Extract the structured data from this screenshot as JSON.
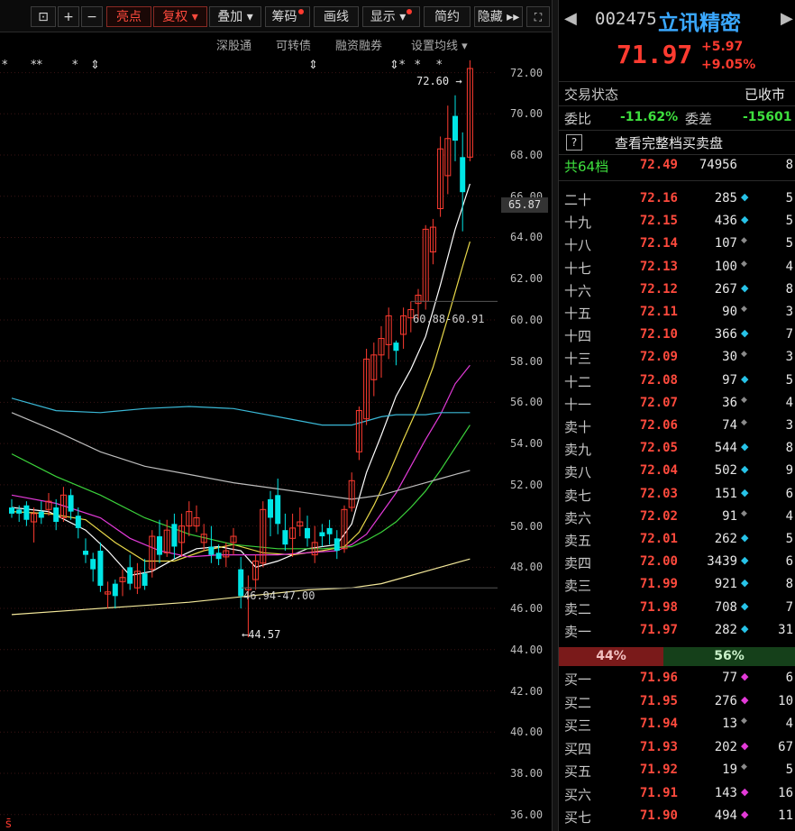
{
  "toolbar": {
    "buttons": [
      "亮点",
      "复权",
      "叠加",
      "筹码",
      "画线",
      "显示",
      "简约",
      "隐藏"
    ],
    "sub": [
      "深股通",
      "可转债",
      "融资融券",
      "设置均线"
    ]
  },
  "chart_data": {
    "type": "candlestick",
    "ylim": [
      35.2,
      72.9
    ],
    "yticks": [
      "72.00",
      "70.00",
      "68.00",
      "66.00",
      "64.00",
      "62.00",
      "60.00",
      "58.00",
      "56.00",
      "54.00",
      "52.00",
      "50.00",
      "48.00",
      "46.00",
      "44.00",
      "42.00",
      "40.00",
      "38.00",
      "36.00"
    ],
    "current_price_label": "65.87",
    "annotations": {
      "high": "72.60",
      "low": "44.57",
      "range_low": "46.94-47.00",
      "range_mid": "60.88-60.91"
    },
    "candles": [
      [
        50.9,
        51.3,
        50.4,
        50.6,
        "d"
      ],
      [
        50.6,
        51.0,
        50.2,
        50.8,
        "d"
      ],
      [
        51.0,
        51.2,
        50.0,
        50.3,
        "d"
      ],
      [
        50.2,
        50.9,
        49.2,
        50.6,
        "u"
      ],
      [
        50.7,
        51.2,
        50.1,
        50.4,
        "d"
      ],
      [
        50.8,
        51.6,
        50.5,
        51.2,
        "u"
      ],
      [
        50.9,
        51.3,
        49.8,
        50.2,
        "d"
      ],
      [
        50.4,
        51.9,
        50.2,
        51.5,
        "u"
      ],
      [
        51.5,
        51.8,
        50.3,
        50.7,
        "d"
      ],
      [
        50.5,
        50.9,
        49.4,
        49.9,
        "d"
      ],
      [
        48.8,
        49.4,
        48.2,
        48.6,
        "d"
      ],
      [
        48.4,
        48.7,
        47.3,
        47.9,
        "d"
      ],
      [
        48.8,
        49.2,
        46.8,
        47.1,
        "d"
      ],
      [
        46.8,
        47.3,
        46.0,
        46.7,
        "u"
      ],
      [
        46.6,
        47.4,
        46.0,
        47.2,
        "d"
      ],
      [
        47.3,
        47.9,
        46.6,
        47.5,
        "u"
      ],
      [
        48.0,
        48.6,
        46.9,
        47.2,
        "d"
      ],
      [
        47.0,
        48.2,
        46.7,
        47.8,
        "u"
      ],
      [
        47.7,
        48.4,
        46.9,
        47.1,
        "d"
      ],
      [
        47.9,
        49.8,
        47.5,
        49.5,
        "u"
      ],
      [
        49.5,
        50.3,
        48.2,
        48.6,
        "d"
      ],
      [
        48.7,
        50.3,
        48.5,
        49.8,
        "u"
      ],
      [
        50.1,
        50.6,
        48.4,
        49.0,
        "d"
      ],
      [
        49.2,
        50.6,
        48.5,
        50.0,
        "u"
      ],
      [
        50.0,
        51.2,
        49.5,
        50.7,
        "u"
      ],
      [
        50.0,
        51.0,
        49.7,
        50.4,
        "u"
      ],
      [
        49.2,
        50.1,
        48.8,
        49.6,
        "u"
      ],
      [
        49.0,
        50.0,
        48.2,
        48.6,
        "d"
      ],
      [
        48.7,
        49.1,
        48.1,
        48.4,
        "d"
      ],
      [
        48.8,
        49.2,
        48.0,
        48.5,
        "u"
      ],
      [
        49.2,
        49.9,
        48.6,
        49.5,
        "u"
      ],
      [
        47.9,
        48.5,
        46.0,
        46.6,
        "d"
      ],
      [
        46.9,
        47.6,
        44.6,
        47.0,
        "u"
      ],
      [
        47.4,
        48.6,
        46.9,
        48.3,
        "u"
      ],
      [
        48.2,
        51.2,
        48.0,
        50.8,
        "u"
      ],
      [
        51.3,
        51.7,
        49.5,
        50.4,
        "d"
      ],
      [
        51.5,
        52.3,
        49.6,
        50.1,
        "d"
      ],
      [
        49.8,
        50.6,
        48.8,
        49.1,
        "d"
      ],
      [
        49.4,
        50.6,
        48.5,
        49.9,
        "u"
      ],
      [
        50.0,
        50.9,
        49.5,
        50.2,
        "u"
      ],
      [
        49.9,
        50.5,
        49.0,
        49.4,
        "d"
      ],
      [
        48.6,
        50.0,
        48.2,
        49.2,
        "u"
      ],
      [
        49.5,
        50.1,
        49.0,
        49.7,
        "d"
      ],
      [
        49.6,
        50.3,
        49.1,
        49.9,
        "d"
      ],
      [
        49.4,
        49.8,
        48.4,
        48.8,
        "d"
      ],
      [
        48.9,
        51.0,
        48.7,
        50.8,
        "u"
      ],
      [
        50.9,
        52.6,
        50.7,
        52.2,
        "u"
      ],
      [
        53.6,
        55.8,
        53.2,
        55.6,
        "u"
      ],
      [
        55.2,
        58.6,
        54.9,
        58.1,
        "u"
      ],
      [
        57.1,
        58.9,
        56.3,
        58.3,
        "u"
      ],
      [
        58.3,
        59.7,
        57.2,
        59.1,
        "u"
      ],
      [
        58.8,
        60.6,
        58.1,
        60.2,
        "u"
      ],
      [
        58.5,
        59.0,
        57.8,
        58.9,
        "d"
      ],
      [
        59.3,
        60.6,
        58.6,
        60.2,
        "u"
      ],
      [
        60.1,
        60.9,
        59.4,
        60.5,
        "u"
      ],
      [
        60.8,
        61.5,
        60.0,
        61.2,
        "u"
      ],
      [
        60.9,
        64.6,
        60.5,
        64.4,
        "u"
      ],
      [
        63.3,
        64.9,
        62.7,
        64.5,
        "u"
      ],
      [
        65.4,
        68.9,
        65.0,
        68.3,
        "u"
      ],
      [
        67.0,
        70.4,
        66.1,
        68.8,
        "u"
      ],
      [
        69.9,
        70.9,
        67.7,
        68.7,
        "d"
      ],
      [
        67.9,
        69.1,
        64.3,
        66.2,
        "d"
      ],
      [
        67.9,
        72.6,
        67.7,
        72.2,
        "u"
      ]
    ],
    "ma_lines": [
      {
        "color": "#ffffff",
        "points": [
          [
            0,
            50.9
          ],
          [
            5,
            50.7
          ],
          [
            10,
            49.8
          ],
          [
            13,
            48.8
          ],
          [
            16,
            47.6
          ],
          [
            19,
            47.8
          ],
          [
            22,
            48.4
          ],
          [
            25,
            48.9
          ],
          [
            28,
            49.0
          ],
          [
            31,
            48.8
          ],
          [
            33,
            48.0
          ],
          [
            36,
            48.3
          ],
          [
            40,
            48.9
          ],
          [
            44,
            49.1
          ],
          [
            46,
            50.1
          ],
          [
            48,
            52.6
          ],
          [
            50,
            54.4
          ],
          [
            52,
            56.3
          ],
          [
            54,
            57.6
          ],
          [
            56,
            59.2
          ],
          [
            58,
            61.7
          ],
          [
            60,
            64.4
          ],
          [
            62,
            66.6
          ]
        ]
      },
      {
        "color": "#e8d84a",
        "points": [
          [
            0,
            50.7
          ],
          [
            5,
            50.6
          ],
          [
            10,
            50.3
          ],
          [
            14,
            49.2
          ],
          [
            18,
            48.3
          ],
          [
            22,
            48.3
          ],
          [
            26,
            48.8
          ],
          [
            30,
            49.1
          ],
          [
            34,
            48.7
          ],
          [
            38,
            48.6
          ],
          [
            42,
            48.8
          ],
          [
            45,
            49.0
          ],
          [
            47,
            49.7
          ],
          [
            49,
            51.0
          ],
          [
            51,
            52.5
          ],
          [
            53,
            54.2
          ],
          [
            55,
            55.8
          ],
          [
            57,
            57.7
          ],
          [
            59,
            60.1
          ],
          [
            61,
            62.6
          ],
          [
            62,
            63.8
          ]
        ]
      },
      {
        "color": "#e23ad8",
        "points": [
          [
            0,
            51.5
          ],
          [
            6,
            51.1
          ],
          [
            12,
            50.4
          ],
          [
            16,
            49.4
          ],
          [
            20,
            48.8
          ],
          [
            24,
            48.5
          ],
          [
            28,
            48.6
          ],
          [
            32,
            48.6
          ],
          [
            36,
            48.6
          ],
          [
            40,
            48.7
          ],
          [
            44,
            48.8
          ],
          [
            46,
            49.1
          ],
          [
            48,
            49.6
          ],
          [
            50,
            50.6
          ],
          [
            52,
            51.6
          ],
          [
            54,
            52.9
          ],
          [
            56,
            54.2
          ],
          [
            58,
            55.4
          ],
          [
            60,
            56.9
          ],
          [
            62,
            57.8
          ]
        ]
      },
      {
        "color": "#3bd23b",
        "points": [
          [
            0,
            53.5
          ],
          [
            6,
            52.4
          ],
          [
            12,
            51.5
          ],
          [
            18,
            50.4
          ],
          [
            24,
            49.6
          ],
          [
            30,
            49.1
          ],
          [
            36,
            48.9
          ],
          [
            42,
            48.9
          ],
          [
            46,
            49.0
          ],
          [
            48,
            49.3
          ],
          [
            50,
            49.7
          ],
          [
            52,
            50.2
          ],
          [
            54,
            50.9
          ],
          [
            56,
            51.7
          ],
          [
            58,
            52.7
          ],
          [
            60,
            53.8
          ],
          [
            62,
            54.9
          ]
        ]
      },
      {
        "color": "#bdbdbd",
        "points": [
          [
            0,
            55.5
          ],
          [
            6,
            54.6
          ],
          [
            12,
            53.6
          ],
          [
            18,
            52.9
          ],
          [
            24,
            52.5
          ],
          [
            30,
            52.1
          ],
          [
            36,
            51.8
          ],
          [
            42,
            51.5
          ],
          [
            46,
            51.3
          ],
          [
            48,
            51.4
          ],
          [
            50,
            51.5
          ],
          [
            52,
            51.7
          ],
          [
            54,
            51.9
          ],
          [
            56,
            52.1
          ],
          [
            58,
            52.3
          ],
          [
            60,
            52.5
          ],
          [
            62,
            52.7
          ]
        ]
      },
      {
        "color": "#3ab8d6",
        "points": [
          [
            0,
            56.2
          ],
          [
            6,
            55.6
          ],
          [
            12,
            55.5
          ],
          [
            18,
            55.7
          ],
          [
            24,
            55.8
          ],
          [
            30,
            55.7
          ],
          [
            36,
            55.3
          ],
          [
            42,
            54.9
          ],
          [
            46,
            54.9
          ],
          [
            48,
            55.1
          ],
          [
            50,
            55.3
          ],
          [
            52,
            55.4
          ],
          [
            54,
            55.4
          ],
          [
            56,
            55.4
          ],
          [
            58,
            55.5
          ],
          [
            60,
            55.5
          ],
          [
            62,
            55.5
          ]
        ]
      },
      {
        "color": "#f3e89a",
        "points": [
          [
            0,
            45.7
          ],
          [
            8,
            45.9
          ],
          [
            16,
            46.1
          ],
          [
            24,
            46.3
          ],
          [
            32,
            46.6
          ],
          [
            40,
            46.9
          ],
          [
            46,
            47.0
          ],
          [
            50,
            47.2
          ],
          [
            54,
            47.6
          ],
          [
            58,
            48.0
          ],
          [
            62,
            48.4
          ]
        ]
      }
    ]
  },
  "quote": {
    "code": "002475",
    "name": "立讯精密",
    "price": "71.97",
    "change": "+5.97",
    "pct": "+9.05%",
    "status_label": "交易状态",
    "status_value": "已收市",
    "weibi_label": "委比",
    "weibi_value": "-11.62%",
    "weicha_label": "委差",
    "weicha_value": "-15601",
    "help_icon": "?",
    "full_book_label": "查看完整档买卖盘",
    "total_label": "共64档",
    "total_price": "72.49",
    "total_vol": "74956",
    "total_cnt": "8",
    "ratio_buy": "44%",
    "ratio_sell": "56%"
  },
  "asks": [
    {
      "lvl": "二十",
      "px": "72.16",
      "vol": "285",
      "mark": "blue",
      "cnt": "5"
    },
    {
      "lvl": "十九",
      "px": "72.15",
      "vol": "436",
      "mark": "blue",
      "cnt": "5"
    },
    {
      "lvl": "十八",
      "px": "72.14",
      "vol": "107",
      "mark": "gray",
      "cnt": "5"
    },
    {
      "lvl": "十七",
      "px": "72.13",
      "vol": "100",
      "mark": "gray",
      "cnt": "4"
    },
    {
      "lvl": "十六",
      "px": "72.12",
      "vol": "267",
      "mark": "blue",
      "cnt": "8"
    },
    {
      "lvl": "十五",
      "px": "72.11",
      "vol": "90",
      "mark": "gray",
      "cnt": "3"
    },
    {
      "lvl": "十四",
      "px": "72.10",
      "vol": "366",
      "mark": "blue",
      "cnt": "7"
    },
    {
      "lvl": "十三",
      "px": "72.09",
      "vol": "30",
      "mark": "gray",
      "cnt": "3"
    },
    {
      "lvl": "十二",
      "px": "72.08",
      "vol": "97",
      "mark": "blue",
      "cnt": "5"
    },
    {
      "lvl": "十一",
      "px": "72.07",
      "vol": "36",
      "mark": "gray",
      "cnt": "4"
    },
    {
      "lvl": "卖十",
      "px": "72.06",
      "vol": "74",
      "mark": "gray",
      "cnt": "3"
    },
    {
      "lvl": "卖九",
      "px": "72.05",
      "vol": "544",
      "mark": "blue",
      "cnt": "8"
    },
    {
      "lvl": "卖八",
      "px": "72.04",
      "vol": "502",
      "mark": "blue",
      "cnt": "9"
    },
    {
      "lvl": "卖七",
      "px": "72.03",
      "vol": "151",
      "mark": "blue",
      "cnt": "6"
    },
    {
      "lvl": "卖六",
      "px": "72.02",
      "vol": "91",
      "mark": "gray",
      "cnt": "4"
    },
    {
      "lvl": "卖五",
      "px": "72.01",
      "vol": "262",
      "mark": "blue",
      "cnt": "5"
    },
    {
      "lvl": "卖四",
      "px": "72.00",
      "vol": "3439",
      "mark": "blue",
      "cnt": "6"
    },
    {
      "lvl": "卖三",
      "px": "71.99",
      "vol": "921",
      "mark": "blue",
      "cnt": "8"
    },
    {
      "lvl": "卖二",
      "px": "71.98",
      "vol": "708",
      "mark": "blue",
      "cnt": "7"
    },
    {
      "lvl": "卖一",
      "px": "71.97",
      "vol": "282",
      "mark": "blue",
      "cnt": "31"
    }
  ],
  "bids": [
    {
      "lvl": "买一",
      "px": "71.96",
      "vol": "77",
      "mark": "pink",
      "cnt": "6"
    },
    {
      "lvl": "买二",
      "px": "71.95",
      "vol": "276",
      "mark": "pink",
      "cnt": "10"
    },
    {
      "lvl": "买三",
      "px": "71.94",
      "vol": "13",
      "mark": "gray",
      "cnt": "4"
    },
    {
      "lvl": "买四",
      "px": "71.93",
      "vol": "202",
      "mark": "pink",
      "cnt": "67"
    },
    {
      "lvl": "买五",
      "px": "71.92",
      "vol": "19",
      "mark": "gray",
      "cnt": "5"
    },
    {
      "lvl": "买六",
      "px": "71.91",
      "vol": "143",
      "mark": "pink",
      "cnt": "16"
    },
    {
      "lvl": "买七",
      "px": "71.90",
      "vol": "494",
      "mark": "pink",
      "cnt": "11"
    }
  ],
  "colors": {
    "up": "#ff3b30",
    "down": "#00e5e5",
    "blue": "#27c3e8",
    "pink": "#e33ad8",
    "gray": "#8a8a8a"
  }
}
